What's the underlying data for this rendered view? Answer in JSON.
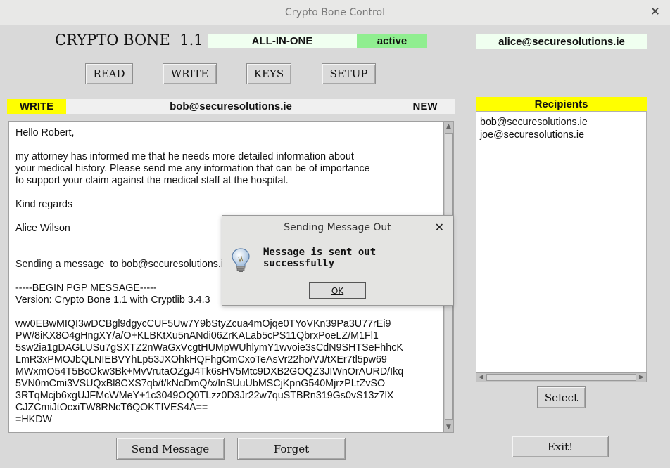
{
  "window": {
    "title": "Crypto Bone Control"
  },
  "header": {
    "app_name": "CRYPTO BONE  1.1",
    "mode": "ALL-IN-ONE",
    "status": "active",
    "user_email": "alice@securesolutions.ie"
  },
  "nav": {
    "read": "READ",
    "write": "WRITE",
    "keys": "KEYS",
    "setup": "SETUP"
  },
  "compose": {
    "mode_label": "WRITE",
    "recipient": "bob@securesolutions.ie",
    "state": "NEW",
    "body": "Hello Robert,\n\nmy attorney has informed me that he needs more detailed information about\nyour medical history. Please send me any information that can be of importance\nto support your claim against the medical staff at the hospital.\n\nKind regards\n\nAlice Wilson\n\n\nSending a message  to bob@securesolutions.ie\n\n-----BEGIN PGP MESSAGE-----\nVersion: Crypto Bone 1.1 with Cryptlib 3.4.3\n\nww0EBwMIQI3wDCBgl9dgycCUF5Uw7Y9bStyZcua4mOjqe0TYoVKn39Pa3U77rEi9\nPW/8iKX8O4gHngXY/a/O+KLBKtXu5nANdi06ZrKALab5cPS11QbrxPoeLZ/M1Fl1\n5sw2ia1gDAGLUSu7gSXTZ2nWaGxVcgtHUMpWUhlymY1wvoie3sCdN9SHTSeFhhcK\nLmR3xPMOJbQLNIEBVYhLp53JXOhkHQFhgCmCxoTeAsVr22ho/VJ/tXEr7tl5pw69\nMWxmO54T5BcOkw3Bk+MvVrutaOZgJ4Tk6sHV5Mtc9DXB2GOQZ3JIWnOrAURD/Ikq\n5VN0mCmi3VSUQxBl8CXS7qb/t/kNcDmQ/x/lnSUuUbMSCjKpnG540MjrzPLtZvSO\n3RTqMcjb6xgUJFMcWMeY+1c3049OQ0TLzz0D3Jr22w7quSTBRn319Gs0vS13z7lX\nCJZCmiJtOcxiTW8RNcT6QOKTIVES4A==\n=HKDW",
    "send_button": "Send Message",
    "forget_button": "Forget"
  },
  "recipients": {
    "title": "Recipients",
    "items": [
      "bob@securesolutions.ie",
      "joe@securesolutions.ie"
    ],
    "select_button": "Select"
  },
  "exit_button": "Exit!",
  "dialog": {
    "title": "Sending Message Out",
    "message": "Message is sent out successfully",
    "ok_button": "OK"
  },
  "colors": {
    "yellow": "#ffff00",
    "green": "#90ee90",
    "pale_green": "#f0fff0"
  }
}
